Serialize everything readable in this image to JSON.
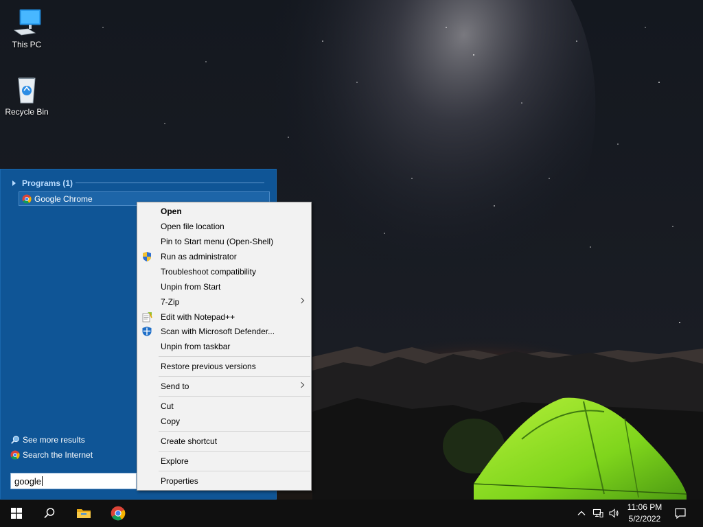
{
  "desktop": {
    "icons": [
      {
        "label": "This PC",
        "icon": "computer-icon"
      },
      {
        "label": "Recycle Bin",
        "icon": "recycle-bin-icon"
      }
    ]
  },
  "start_menu": {
    "programs_header": "Programs (1)",
    "results": [
      {
        "label": "Google Chrome",
        "icon": "chrome-icon"
      }
    ],
    "see_more": "See more results",
    "search_internet": "Search the Internet",
    "search_value": "google"
  },
  "context_menu": {
    "items": [
      {
        "label": "Open",
        "bold": true
      },
      {
        "label": "Open file location"
      },
      {
        "label": "Pin to Start menu (Open-Shell)"
      },
      {
        "label": "Run as administrator",
        "icon": "uac-shield-icon"
      },
      {
        "label": "Troubleshoot compatibility"
      },
      {
        "label": "Unpin from Start"
      },
      {
        "label": "7-Zip",
        "submenu": true
      },
      {
        "label": "Edit with Notepad++",
        "icon": "notepad-plus-plus-icon"
      },
      {
        "label": "Scan with Microsoft Defender...",
        "icon": "defender-icon"
      },
      {
        "label": "Unpin from taskbar"
      },
      {
        "label": "Restore previous versions"
      },
      {
        "label": "Send to",
        "submenu": true
      },
      {
        "label": "Cut"
      },
      {
        "label": "Copy"
      },
      {
        "label": "Create shortcut"
      },
      {
        "label": "Explore"
      },
      {
        "label": "Properties"
      }
    ]
  },
  "taskbar": {
    "pinned": [
      "start-icon",
      "search-icon",
      "file-explorer-icon",
      "chrome-icon"
    ],
    "tray": [
      "chevron-up-icon",
      "network-icon",
      "volume-icon"
    ],
    "time": "11:06 PM",
    "date": "5/2/2022",
    "notification_icon": "action-center-icon"
  },
  "colors": {
    "start_menu_bg": "#0f5596",
    "context_menu_bg": "#f2f2f2",
    "taskbar_bg": "#101010",
    "programs_header": "#b9dcff"
  }
}
